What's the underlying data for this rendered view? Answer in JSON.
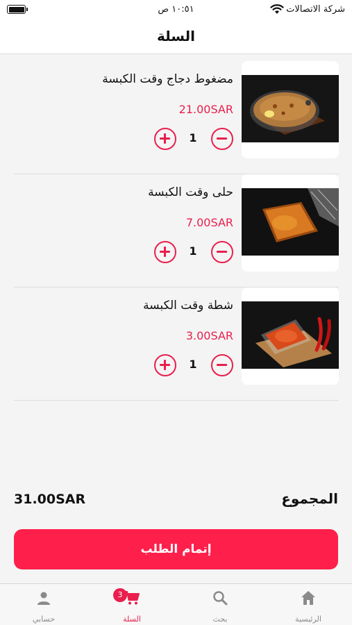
{
  "status_bar": {
    "carrier": "شركة الاتصالات",
    "time": "١٠:٥١ ص"
  },
  "header": {
    "title": "السلة"
  },
  "cart": {
    "items": [
      {
        "name": "مضغوط دجاج وقت الكبسة",
        "price": "21.00SAR",
        "quantity": "1",
        "image_icon": "kabsa-rice-dish-image"
      },
      {
        "name": "حلى وقت الكبسة",
        "price": "7.00SAR",
        "quantity": "1",
        "image_icon": "dessert-tray-image"
      },
      {
        "name": "شطة وقت الكبسة",
        "price": "3.00SAR",
        "quantity": "1",
        "image_icon": "chili-sauce-image"
      }
    ]
  },
  "summary": {
    "total_label": "المجموع",
    "total_value": "31.00SAR"
  },
  "checkout": {
    "label": "إتمام الطلب"
  },
  "tab_bar": {
    "tabs": [
      {
        "label": "الرئيسية",
        "icon": "home-icon"
      },
      {
        "label": "بحث",
        "icon": "search-icon"
      },
      {
        "label": "السلة",
        "icon": "cart-icon",
        "badge": "3",
        "active": true
      },
      {
        "label": "حسابي",
        "icon": "user-icon"
      }
    ]
  },
  "colors": {
    "accent": "#e91e4c",
    "button": "#ff1f4b",
    "background": "#f4f4f4"
  }
}
